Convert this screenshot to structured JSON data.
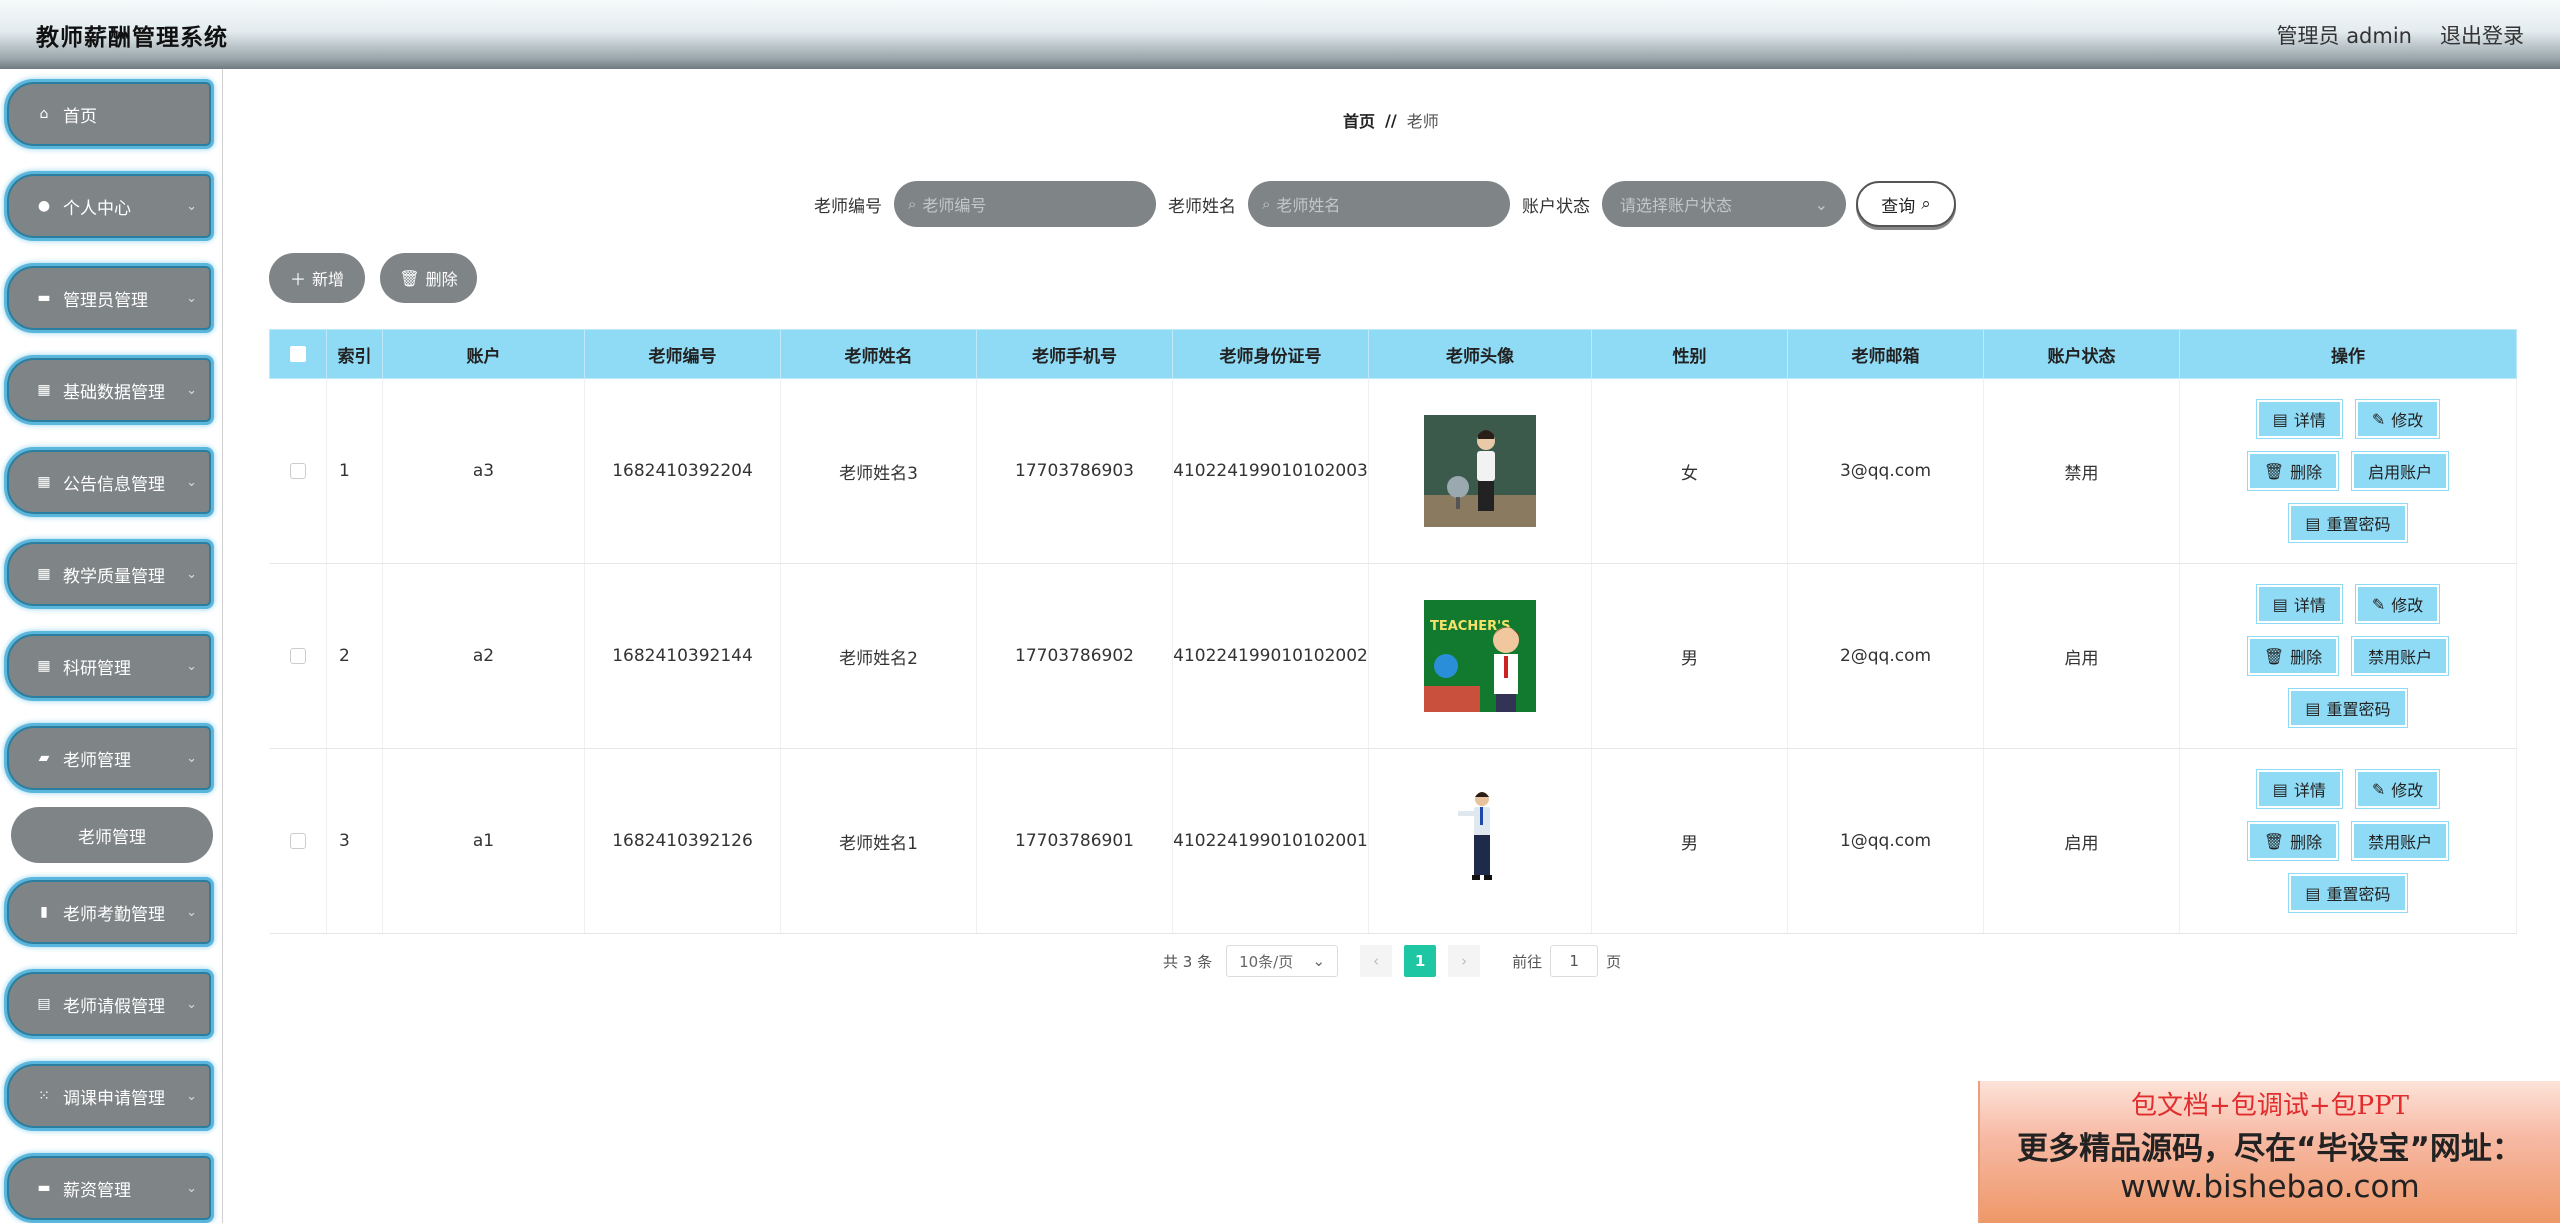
{
  "header": {
    "title": "教师薪酬管理系统",
    "user": "管理员 admin",
    "logout": "退出登录"
  },
  "sidebar": {
    "items": [
      {
        "label": "首页",
        "icon": "home-icon",
        "expandable": false
      },
      {
        "label": "个人中心",
        "icon": "user-icon",
        "expandable": true
      },
      {
        "label": "管理员管理",
        "icon": "chat-icon",
        "expandable": true
      },
      {
        "label": "基础数据管理",
        "icon": "grid-icon",
        "expandable": true
      },
      {
        "label": "公告信息管理",
        "icon": "grid-icon",
        "expandable": true
      },
      {
        "label": "教学质量管理",
        "icon": "grid-icon",
        "expandable": true
      },
      {
        "label": "科研管理",
        "icon": "grid-icon",
        "expandable": true
      },
      {
        "label": "老师管理",
        "icon": "briefcase-icon",
        "expandable": true
      },
      {
        "label": "老师考勤管理",
        "icon": "bar-chart-icon",
        "expandable": true
      },
      {
        "label": "老师请假管理",
        "icon": "clipboard-icon",
        "expandable": true
      },
      {
        "label": "调课申请管理",
        "icon": "apps-icon",
        "expandable": true
      },
      {
        "label": "薪资管理",
        "icon": "card-icon",
        "expandable": true
      }
    ],
    "submenu": {
      "label": "老师管理"
    }
  },
  "breadcrumb": {
    "home": "首页",
    "separator": "//",
    "current": "老师"
  },
  "search": {
    "teacher_no_label": "老师编号",
    "teacher_no_placeholder": "老师编号",
    "teacher_name_label": "老师姓名",
    "teacher_name_placeholder": "老师姓名",
    "status_label": "账户状态",
    "status_placeholder": "请选择账户状态",
    "query_label": "查询"
  },
  "actions": {
    "add": "新增",
    "delete": "删除"
  },
  "table": {
    "columns": [
      "索引",
      "账户",
      "老师编号",
      "老师姓名",
      "老师手机号",
      "老师身份证号",
      "老师头像",
      "性别",
      "老师邮箱",
      "账户状态",
      "操作"
    ],
    "rows": [
      {
        "index": "1",
        "account": "a3",
        "teacher_no": "1682410392204",
        "name": "老师姓名3",
        "phone": "17703786903",
        "id_card": "410224199010102003",
        "gender": "女",
        "email": "3@qq.com",
        "status": "禁用",
        "toggle_label": "启用账户"
      },
      {
        "index": "2",
        "account": "a2",
        "teacher_no": "1682410392144",
        "name": "老师姓名2",
        "phone": "17703786902",
        "id_card": "410224199010102002",
        "gender": "男",
        "email": "2@qq.com",
        "status": "启用",
        "toggle_label": "禁用账户"
      },
      {
        "index": "3",
        "account": "a1",
        "teacher_no": "1682410392126",
        "name": "老师姓名1",
        "phone": "17703786901",
        "id_card": "410224199010102001",
        "gender": "男",
        "email": "1@qq.com",
        "status": "启用",
        "toggle_label": "禁用账户"
      }
    ],
    "op_labels": {
      "detail": "详情",
      "edit": "修改",
      "delete": "删除",
      "reset": "重置密码"
    },
    "avatar_text": "TEACHER'S"
  },
  "pagination": {
    "total": "共 3 条",
    "page_size": "10条/页",
    "current_page": "1",
    "goto_label": "前往",
    "goto_value": "1",
    "page_suffix": "页"
  },
  "watermark": {
    "line1": "包文档+包调试+包PPT",
    "line2": "更多精品源码，尽在“毕设宝”网址：",
    "line3": "www.bishebao.com"
  },
  "colors": {
    "sidebar_item": "#7f8486",
    "table_header": "#8fdbf5",
    "active_page": "#1fc6a4"
  }
}
